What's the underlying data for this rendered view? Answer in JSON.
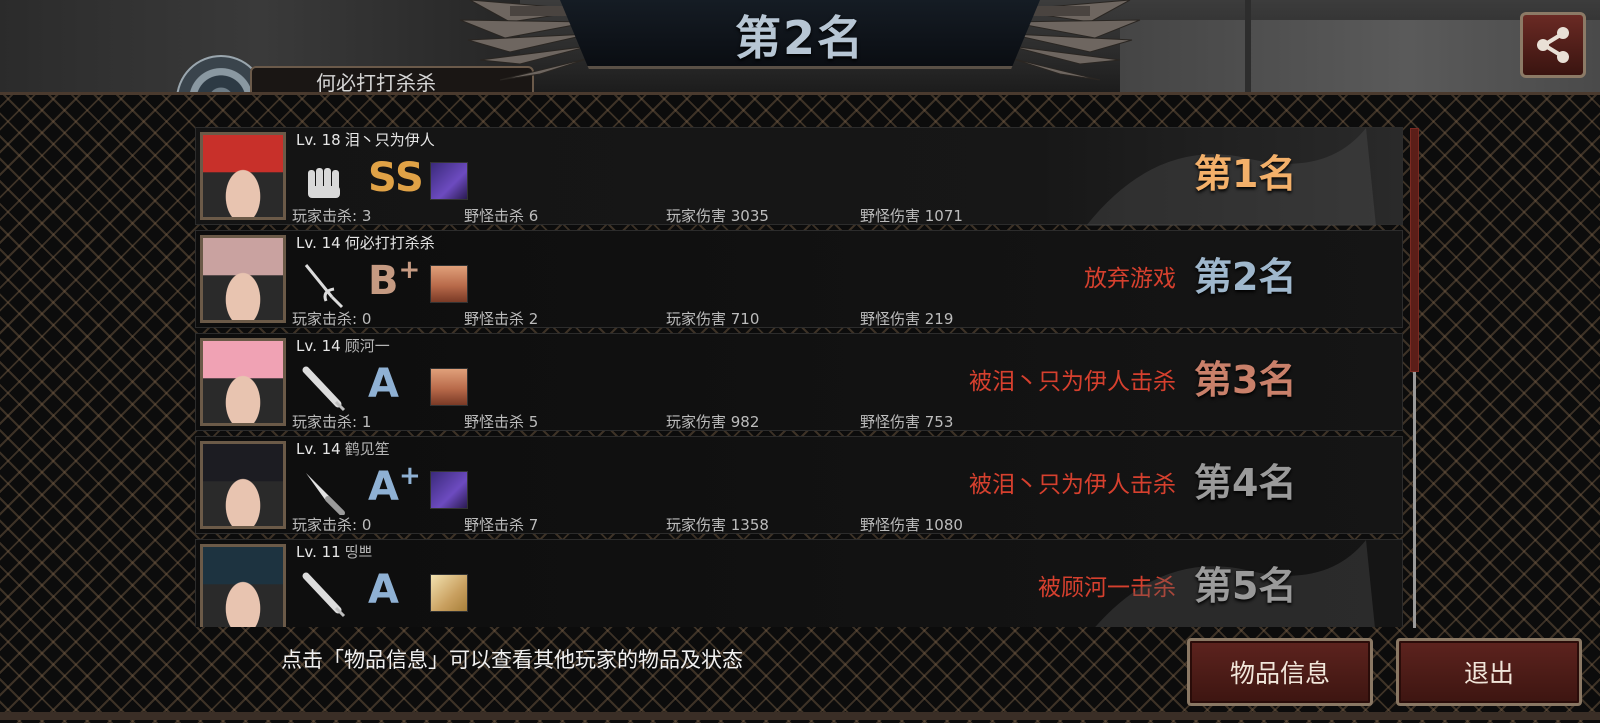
{
  "header": {
    "title": "第2名",
    "player_plate": "何必打打杀杀"
  },
  "results": [
    {
      "level": "Lv. 18",
      "name": "泪丶只为伊人",
      "grade": "SS",
      "grade_plus": "",
      "grade_color": "#e0a246",
      "weapon_icon": "fist-icon",
      "skill_icon": "purple-beast-skill-icon",
      "player_kills_label": "玩家击杀: 3",
      "monster_kills_label": "野怪击杀 6",
      "player_damage_label": "玩家伤害 3035",
      "monster_damage_label": "野怪伤害 1071",
      "cause": "",
      "rank": "第1名",
      "hair": "#c8302a"
    },
    {
      "level": "Lv. 14",
      "name": "何必打打杀杀",
      "grade": "B",
      "grade_plus": "+",
      "grade_color": "#c59a82",
      "weapon_icon": "rapier-icon",
      "skill_icon": "sunglasses-face-skill-icon",
      "player_kills_label": "玩家击杀: 0",
      "monster_kills_label": "野怪击杀 2",
      "player_damage_label": "玩家伤害 710",
      "monster_damage_label": "野怪伤害 219",
      "cause": "放弃游戏",
      "rank": "第2名",
      "hair": "#c9a2a0"
    },
    {
      "level": "Lv. 14",
      "name": "顾河一",
      "grade": "A",
      "grade_plus": "",
      "grade_color": "#8fb1d4",
      "weapon_icon": "baseball-bat-icon",
      "skill_icon": "sunglasses-face-skill-icon",
      "player_kills_label": "玩家击杀: 1",
      "monster_kills_label": "野怪击杀 5",
      "player_damage_label": "玩家伤害 982",
      "monster_damage_label": "野怪伤害 753",
      "cause": "被泪丶只为伊人击杀",
      "rank": "第3名",
      "hair": "#f0a2b4"
    },
    {
      "level": "Lv. 14",
      "name": "鹤见笙",
      "grade": "A",
      "grade_plus": "+",
      "grade_color": "#8fb1d4",
      "weapon_icon": "kitchen-knife-icon",
      "skill_icon": "purple-beast-skill-icon",
      "player_kills_label": "玩家击杀: 0",
      "monster_kills_label": "野怪击杀 7",
      "player_damage_label": "玩家伤害 1358",
      "monster_damage_label": "野怪伤害 1080",
      "cause": "被泪丶只为伊人击杀",
      "rank": "第4名",
      "hair": "#1c1c22"
    },
    {
      "level": "Lv. 11",
      "name": "띵쁘",
      "grade": "A",
      "grade_plus": "",
      "grade_color": "#8fb1d4",
      "weapon_icon": "baseball-bat-icon",
      "skill_icon": "bandage-skill-icon",
      "player_kills_label": "",
      "monster_kills_label": "",
      "player_damage_label": "",
      "monster_damage_label": "",
      "cause": "被顾河一击杀",
      "rank": "第5名",
      "hair": "#1d3340"
    }
  ],
  "footer": {
    "hint": "点击「物品信息」可以查看其他玩家的物品及状态",
    "items_button": "物品信息",
    "quit_button": "退出"
  },
  "icons": {
    "share": "share-icon"
  },
  "colors": {
    "cause_red": "#d6402e",
    "button_red": "#5d231e",
    "rank1": "#f3b06a",
    "rank2": "#9fb7cc",
    "rank3": "#c9806a"
  }
}
